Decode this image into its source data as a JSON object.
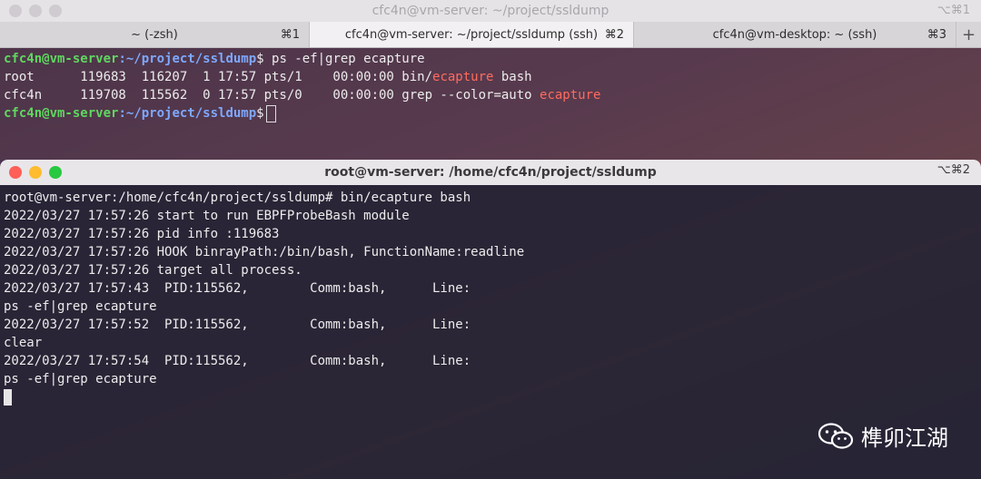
{
  "window1": {
    "title": "cfc4n@vm-server: ~/project/ssldump",
    "shortcut": "⌥⌘1",
    "tabs": [
      {
        "label": "~ (-zsh)",
        "shortcut": "⌘1"
      },
      {
        "label": "cfc4n@vm-server: ~/project/ssldump (ssh)",
        "shortcut": "⌘2"
      },
      {
        "label": "cfc4n@vm-desktop: ~ (ssh)",
        "shortcut": "⌘3"
      }
    ],
    "add_tab": "+",
    "prompt_user": "cfc4n@vm-server",
    "prompt_path": ":~/project/ssldump",
    "prompt_symbol": "$",
    "command": " ps -ef|grep ecapture",
    "out1_pre": "root      119683  116207  1 17:57 pts/1    00:00:00 bin/",
    "out1_hl": "ecapture",
    "out1_post": " bash",
    "out2_pre": "cfc4n     119708  115562  0 17:57 pts/0    00:00:00 grep --color=auto ",
    "out2_hl": "ecapture"
  },
  "window2": {
    "title": "root@vm-server: /home/cfc4n/project/ssldump",
    "shortcut": "⌥⌘2",
    "lines": [
      "root@vm-server:/home/cfc4n/project/ssldump# bin/ecapture bash",
      "2022/03/27 17:57:26 start to run EBPFProbeBash module",
      "2022/03/27 17:57:26 pid info :119683",
      "2022/03/27 17:57:26 HOOK binrayPath:/bin/bash, FunctionName:readline",
      "2022/03/27 17:57:26 target all process.",
      "2022/03/27 17:57:43  PID:115562,        Comm:bash,      Line:",
      "ps -ef|grep ecapture",
      "2022/03/27 17:57:52  PID:115562,        Comm:bash,      Line:",
      "clear",
      "2022/03/27 17:57:54  PID:115562,        Comm:bash,      Line:",
      "ps -ef|grep ecapture"
    ]
  },
  "watermark": {
    "text": "榫卯江湖",
    "icon": "wechat-icon"
  }
}
